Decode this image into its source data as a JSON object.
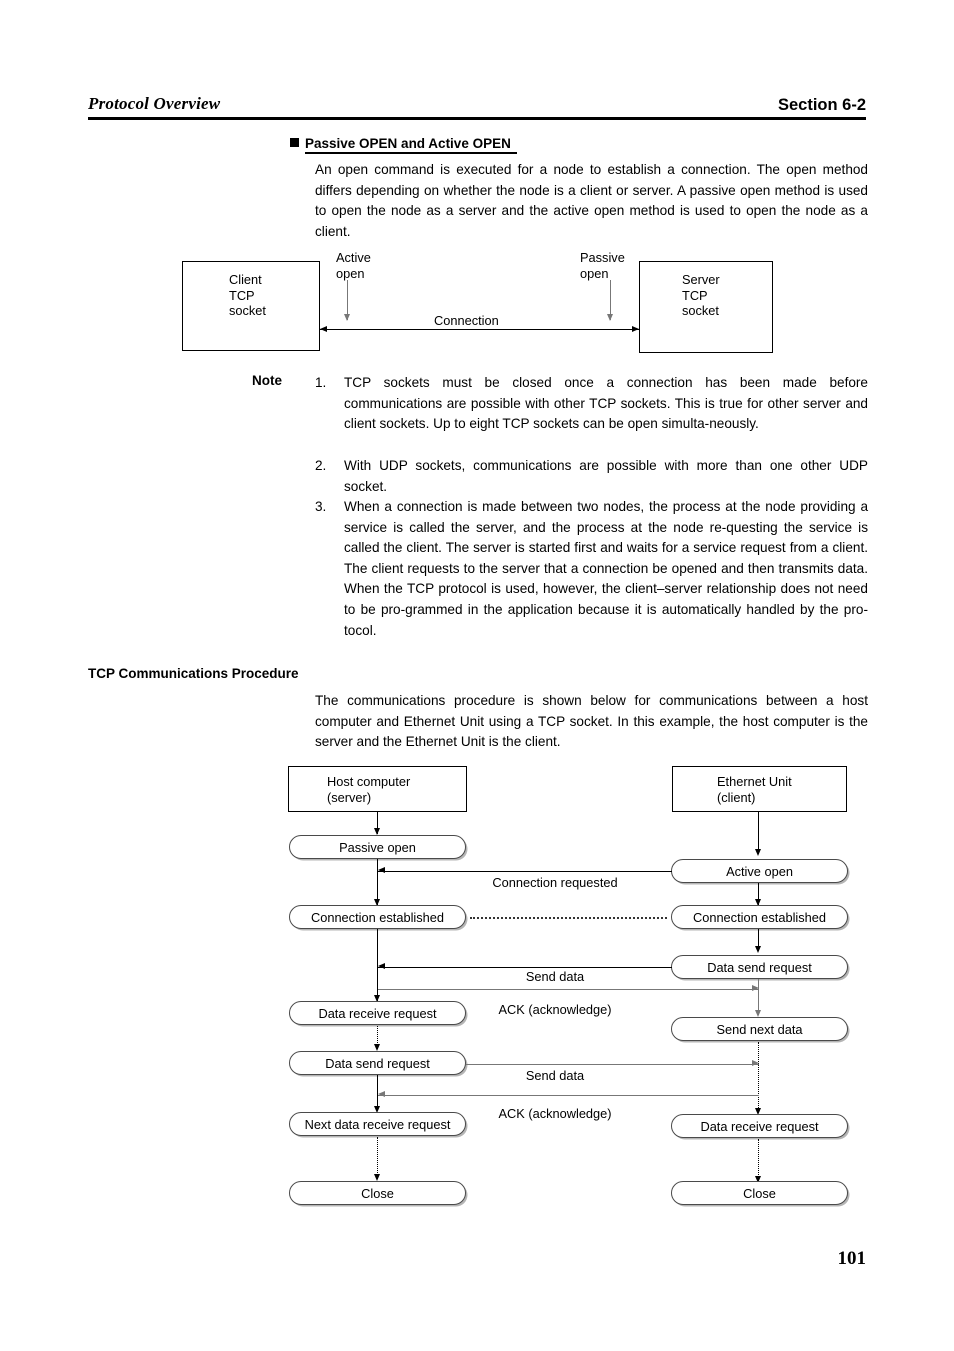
{
  "header": {
    "title": "Protocol Overview",
    "section": "Section 6-2"
  },
  "sections": [
    {
      "heading": "Passive OPEN and Active OPEN",
      "paragraph": "An open command is executed for a node to establish a connection. The open method differs depending on whether the node is a client or server. A passive open method is used to open the node as a server and the active open method is used to open the node as a client."
    },
    {
      "heading": "TCP Communications Procedure",
      "paragraph": "The communications procedure is shown below for communications between a host computer and Ethernet Unit using a TCP socket. In this example, the host computer is the server and the Ethernet Unit is the client."
    }
  ],
  "note": {
    "label": "Note",
    "items": [
      {
        "number": "1.",
        "text": "TCP sockets must be closed once a connection has been made before communications are possible with other TCP sockets. This is true for other server and client sockets. Up to eight TCP sockets can be open simulta-neously."
      },
      {
        "number": "2.",
        "text": "With UDP sockets, communications are possible with more than one other UDP socket."
      },
      {
        "number": "3.",
        "text": "When a connection is made between two nodes, the process at the node providing a service is called the server, and the process at the node re-questing the service is called the client. The server is started first and waits for a service request from a client. The client requests to the server that a connection be opened and then transmits data. When the TCP protocol is used, however, the client–server relationship does not need to be pro-grammed in the application because it is automatically handled by the pro-tocol."
      }
    ]
  },
  "open_diagram": {
    "client_box": "Client\nTCP\nsocket",
    "client_box_lines": [
      "Client",
      "TCP",
      "socket"
    ],
    "server_box_lines": [
      "Server",
      "TCP",
      "socket"
    ],
    "active_open_label": [
      "Active",
      "open"
    ],
    "passive_open_label": [
      "Passive",
      "open"
    ],
    "connection_label": "Connection"
  },
  "sequence_diagram": {
    "left_actor": [
      "Host computer",
      "(server)"
    ],
    "right_actor": [
      "Ethernet Unit",
      "(client)"
    ],
    "left_steps": [
      "Passive open",
      "Connection established",
      "Data receive request",
      "Data send request",
      "Next data receive request",
      "Close"
    ],
    "right_steps": [
      "Active open",
      "Connection established",
      "Data send request",
      "Send next data",
      "Data receive request",
      "Close"
    ],
    "messages": [
      "Connection requested",
      "Send data",
      "ACK (acknowledge)",
      "Send data",
      "ACK (acknowledge)"
    ]
  },
  "footer": {
    "page_number": "101"
  }
}
